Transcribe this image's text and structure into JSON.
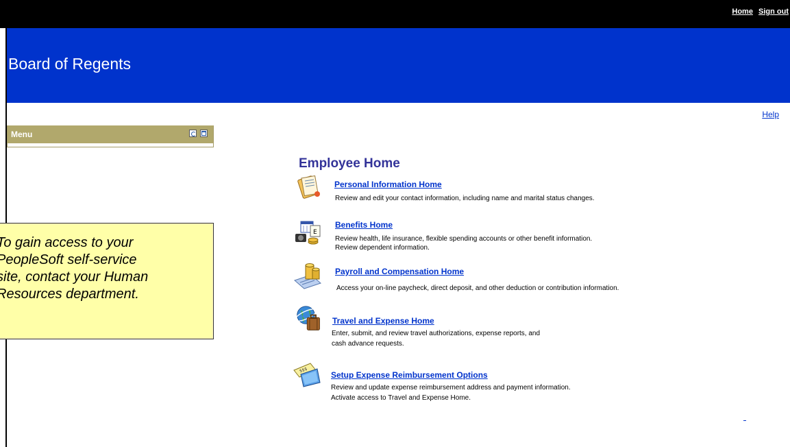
{
  "header": {
    "links": [
      "Home",
      "Sign out"
    ],
    "title": "Board of Regents",
    "help": "Help"
  },
  "menu": {
    "title": "Menu",
    "refresh_icon": "refresh-icon",
    "maximize_icon": "maximize-icon"
  },
  "callout": {
    "lines": [
      "To gain access to your",
      "PeopleSoft self-service",
      "site, contact your Human",
      "Resources department."
    ]
  },
  "main": {
    "title": "Employee Home",
    "items": [
      {
        "icon": "document-folder-icon",
        "link": "Personal Information Home",
        "desc": [
          "Review and edit your contact information, including name and marital status changes."
        ]
      },
      {
        "icon": "benefits-calendar-icon",
        "link": "Benefits Home",
        "desc": [
          "Review health, life insurance, flexible spending accounts or other benefit information.",
          "Review dependent information."
        ]
      },
      {
        "icon": "payroll-coins-check-icon",
        "link": "Payroll and Compensation Home",
        "desc": [
          "Access your on-line paycheck, direct deposit, and other deduction or contribution information."
        ]
      },
      {
        "icon": "globe-luggage-icon",
        "link": "Travel and Expense Home",
        "desc": [
          "Enter, submit, and review travel authorizations, expense reports, and",
          "cash advance requests."
        ]
      },
      {
        "icon": "expense-options-icon",
        "link": "Setup Expense Reimbursement Options",
        "desc": [
          "Review and update expense reimbursement address and payment information.",
          "Activate access to Travel and Expense Home."
        ]
      }
    ]
  },
  "colors": {
    "banner": "#0033cc",
    "topbar": "#000000",
    "menu_header": "#b1a86c",
    "callout": "#ffffa8",
    "title": "#333399",
    "link": "#0033cc"
  }
}
